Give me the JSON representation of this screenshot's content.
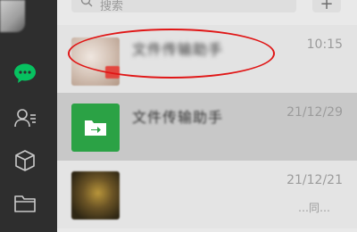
{
  "search": {
    "placeholder": "搜索"
  },
  "add_button": {
    "label": "+"
  },
  "nav": {
    "items": [
      {
        "name": "chat",
        "icon": "chat-bubble-icon",
        "active": true
      },
      {
        "name": "contacts",
        "icon": "contacts-icon",
        "active": false
      },
      {
        "name": "favorites",
        "icon": "cube-icon",
        "active": false
      },
      {
        "name": "files",
        "icon": "folder-icon",
        "active": false
      }
    ]
  },
  "chats": [
    {
      "title": "文件传输助手",
      "snippet": "",
      "time": "10:15",
      "thumbnail": "photo-avatar",
      "blurred": true
    },
    {
      "title": "文件传输助手",
      "snippet": "",
      "time": "21/12/29",
      "thumbnail": "file-transfer-icon",
      "blurred": true
    },
    {
      "title": "",
      "snippet": "",
      "snippet_tail": "…同…",
      "time": "21/12/21",
      "thumbnail": "photo-avatar",
      "blurred": true
    }
  ],
  "colors": {
    "rail": "#2e2e2e",
    "accent_green": "#07c160",
    "file_transfer_green": "#2ba245",
    "annotation_red": "#e01616",
    "selected_row": "#c8c8c8"
  }
}
